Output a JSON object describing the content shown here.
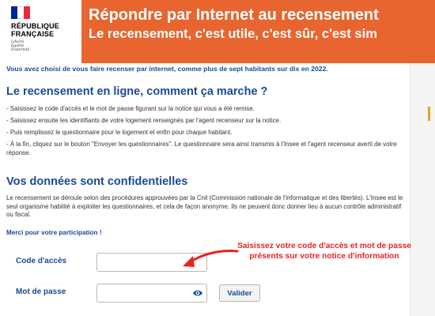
{
  "header": {
    "logo": {
      "line1": "RÉPUBLIQUE",
      "line2": "FRANÇAISE",
      "motto": [
        "Liberté",
        "Égalité",
        "Fraternité"
      ]
    },
    "title": "Répondre par Internet au recensement",
    "subtitle": "Le recensement, c'est utile, c'est sûr, c'est sim"
  },
  "intro": "Vous avez choisi de vous faire recenser par internet, comme plus de sept habitants sur dix en 2022.",
  "section_how": {
    "heading": "Le recensement en ligne, comment ça marche ?",
    "steps": [
      "- Saisissez le code d'accès et le mot de passe figurant sur la notice qui vous a été remise.",
      "- Saisissez ensuite les identifiants de votre logement renseignés par l'agent recenseur sur la notice.",
      "- Puis remplissez le questionnaire pour le logement et enfin pour chaque habitant.",
      "- À la fin, cliquez sur le bouton \"Envoyer les questionnaires\". Le questionnaire sera ainsi transmis à l'Insee et l'agent recenseur averti de votre réponse."
    ]
  },
  "section_conf": {
    "heading": "Vos données sont confidentielles",
    "text": "Le recensement se déroule selon des procédures approuvées par la Cnil (Commission nationale de l'informatique et des libertés). L'Insee est le seul organisme habilité à exploiter les questionnaires, et cela de façon anonyme. Ils ne peuvent donc donner lieu à aucun contrôle administratif ou fiscal."
  },
  "thanks": "Merci pour votre participation !",
  "form": {
    "code_label": "Code d'accès",
    "code_value": "",
    "password_label": "Mot de passe",
    "password_value": "",
    "submit_label": "Valider"
  },
  "callout": "Saisissez votre code d'accès et mot de passe présents sur votre notice d'information",
  "colors": {
    "header_bg": "#e8652f",
    "heading_blue": "#1a4a96",
    "callout_red": "#e8231f"
  },
  "icons": {
    "eye": "eye-icon",
    "arrow": "red-arrow-icon"
  }
}
